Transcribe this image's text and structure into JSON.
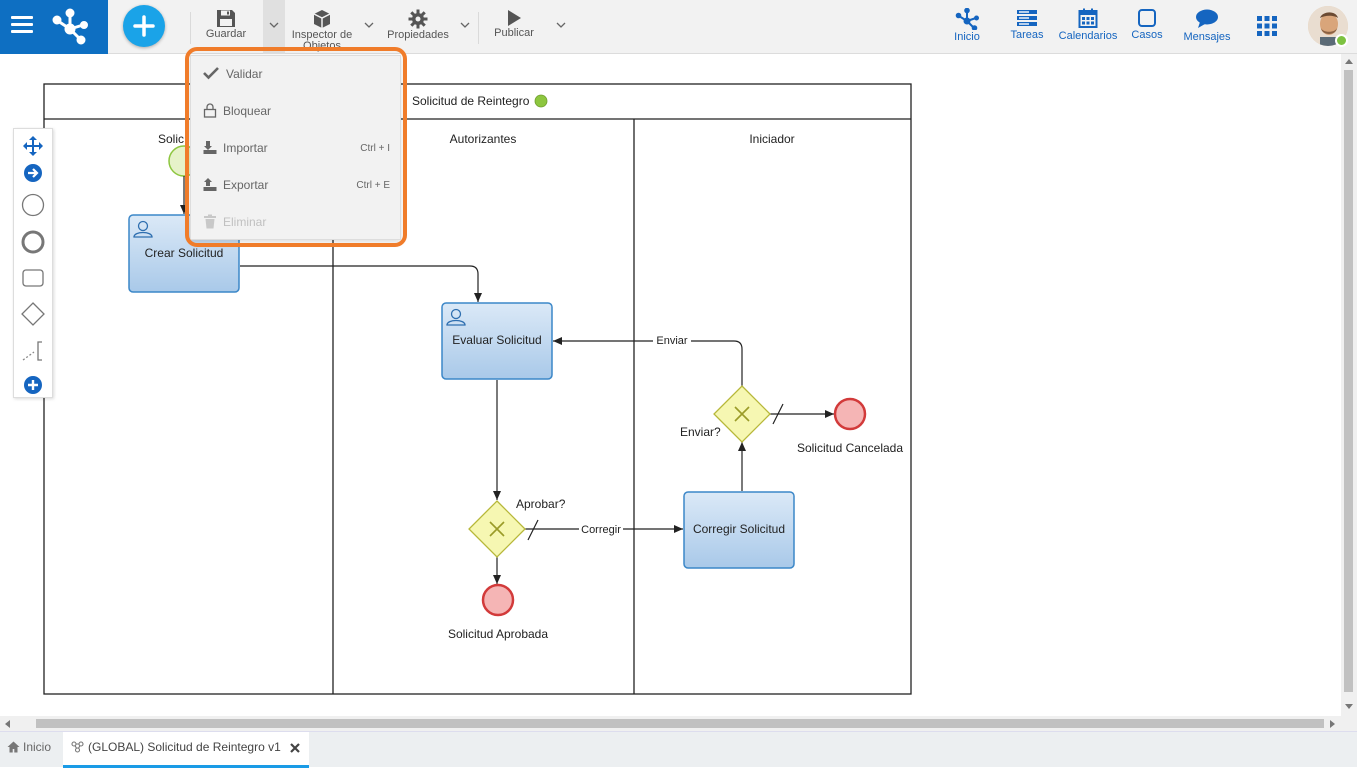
{
  "header": {
    "toolbar": {
      "save": "Guardar",
      "inspector": "Inspector de Objetos",
      "properties": "Propiedades",
      "publish": "Publicar"
    },
    "nav": [
      {
        "label": "Inicio",
        "icon": "home-network-icon"
      },
      {
        "label": "Tareas",
        "icon": "tasks-icon"
      },
      {
        "label": "Calendarios",
        "icon": "calendar-icon"
      },
      {
        "label": "Casos",
        "icon": "cases-icon"
      },
      {
        "label": "Mensajes",
        "icon": "messages-icon"
      }
    ]
  },
  "save_menu": {
    "items": [
      {
        "label": "Validar",
        "shortcut": "",
        "enabled": true,
        "icon": "check-icon"
      },
      {
        "label": "Bloquear",
        "shortcut": "",
        "enabled": true,
        "icon": "lock-icon"
      },
      {
        "label": "Importar",
        "shortcut": "Ctrl + I",
        "enabled": true,
        "icon": "import-icon"
      },
      {
        "label": "Exportar",
        "shortcut": "Ctrl + E",
        "enabled": true,
        "icon": "export-icon"
      },
      {
        "label": "Eliminar",
        "shortcut": "",
        "enabled": false,
        "icon": "trash-icon"
      }
    ]
  },
  "diagram": {
    "pool": "Solicitud de Reintegro",
    "lanes": [
      "Solicitante",
      "Autorizantes",
      "Iniciador"
    ],
    "lane_visible_labels": [
      "Solic",
      "Autorizantes",
      "Iniciador"
    ],
    "tasks": {
      "create": "Crear Solicitud",
      "evaluate": "Evaluar Solicitud",
      "correct": "Corregir Solicitud"
    },
    "gateways": {
      "approve": "Aprobar?",
      "send": "Enviar?"
    },
    "flows": {
      "correct": "Corregir",
      "send": "Enviar"
    },
    "end_events": {
      "approved": "Solicitud Aprobada",
      "cancelled": "Solicitud Cancelada"
    },
    "colors": {
      "task_fill": "#bcd6ee",
      "task_border": "#3b87c8",
      "gateway_fill": "#f6f7b2",
      "end_fill": "#f5b5b5",
      "end_border": "#d23a3a",
      "status": "#8dc63f"
    }
  },
  "tabs": [
    {
      "label": "Inicio",
      "icon": "home-icon"
    },
    {
      "label": "(GLOBAL) Solicitud de Reintegro v1",
      "icon": "process-icon",
      "active": true
    }
  ]
}
